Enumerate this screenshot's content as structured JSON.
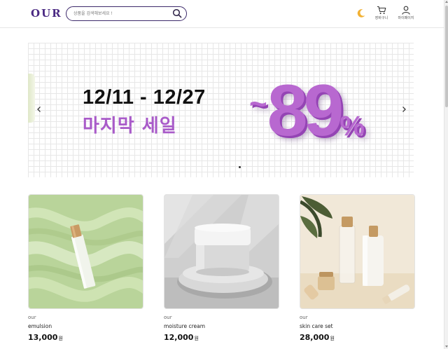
{
  "header": {
    "logo": "OUR",
    "search_placeholder": "상품을 검색해보세요 !",
    "cart_label": "장바구니",
    "mypage_label": "마이페이지"
  },
  "banner": {
    "date": "12/11 - 12/27",
    "title": "마지막 세일",
    "discount_prefix": "~",
    "discount_number": "89",
    "discount_suffix": "%"
  },
  "products": [
    {
      "brand": "our",
      "name": "emulsion",
      "price": "13,000",
      "currency": "원"
    },
    {
      "brand": "our",
      "name": "moisture cream",
      "price": "12,000",
      "currency": "원"
    },
    {
      "brand": "our",
      "name": "skin care set",
      "price": "28,000",
      "currency": "원"
    }
  ],
  "colors": {
    "brand": "#4b2a83",
    "accent": "#b868d0"
  }
}
